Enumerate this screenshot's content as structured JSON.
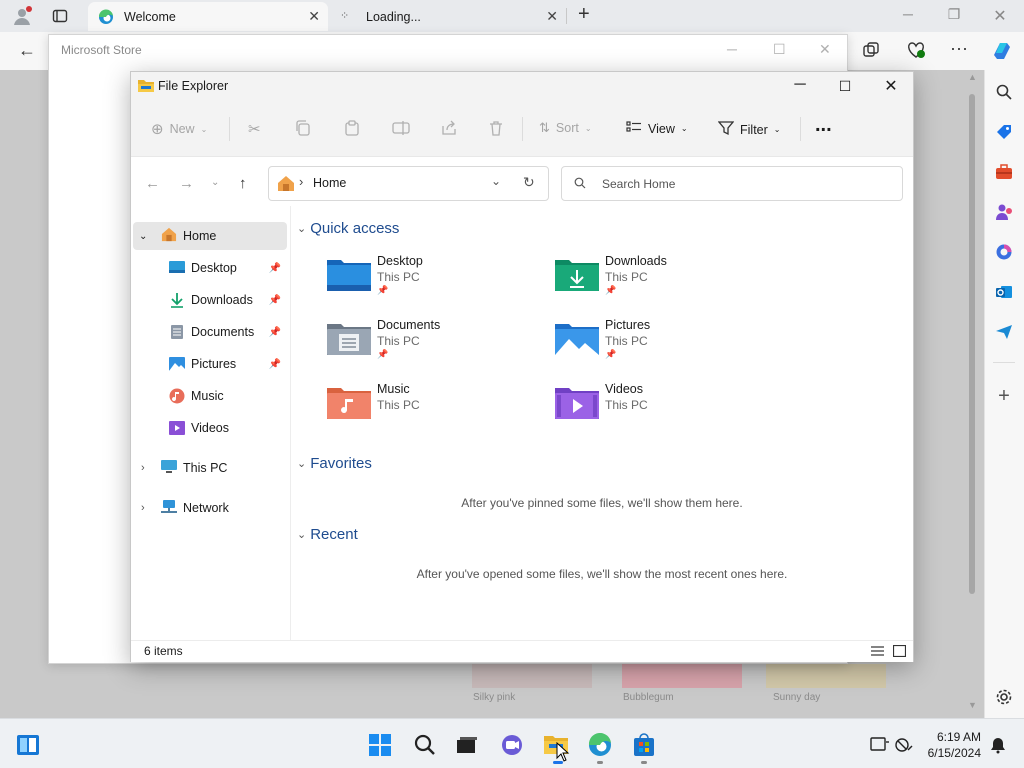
{
  "browser": {
    "tabs": [
      {
        "label": "Welcome",
        "active": true
      },
      {
        "label": "Loading...",
        "active": false
      }
    ],
    "new_tab_label": "+"
  },
  "store": {
    "title": "Microsoft Store",
    "swatches": [
      {
        "label": "Silky pink",
        "color": "#e8cfcf"
      },
      {
        "label": "Bubblegum",
        "color": "#f6c5cf"
      },
      {
        "label": "Sunny day",
        "color": "#f3e6c6"
      }
    ]
  },
  "explorer": {
    "title": "File Explorer",
    "commands": {
      "new": "New",
      "sort": "Sort",
      "view": "View",
      "filter": "Filter",
      "more": "..."
    },
    "address": {
      "location": "Home"
    },
    "search": {
      "placeholder": "Search Home"
    },
    "nav_pane": {
      "home": "Home",
      "items": [
        {
          "label": "Desktop",
          "pinned": true
        },
        {
          "label": "Downloads",
          "pinned": true
        },
        {
          "label": "Documents",
          "pinned": true
        },
        {
          "label": "Pictures",
          "pinned": true
        },
        {
          "label": "Music",
          "pinned": false
        },
        {
          "label": "Videos",
          "pinned": false
        }
      ],
      "this_pc": "This PC",
      "network": "Network"
    },
    "quick_access": {
      "title": "Quick access",
      "items": [
        {
          "name": "Desktop",
          "location": "This PC",
          "pinned": true
        },
        {
          "name": "Downloads",
          "location": "This PC",
          "pinned": true
        },
        {
          "name": "Documents",
          "location": "This PC",
          "pinned": true
        },
        {
          "name": "Pictures",
          "location": "This PC",
          "pinned": true
        },
        {
          "name": "Music",
          "location": "This PC",
          "pinned": false
        },
        {
          "name": "Videos",
          "location": "This PC",
          "pinned": false
        }
      ]
    },
    "favorites": {
      "title": "Favorites",
      "empty_text": "After you've pinned some files, we'll show them here."
    },
    "recent": {
      "title": "Recent",
      "empty_text": "After you've opened some files, we'll show the most recent ones here."
    },
    "status": "6 items"
  },
  "taskbar": {
    "time": "6:19 AM",
    "date": "6/15/2024"
  }
}
